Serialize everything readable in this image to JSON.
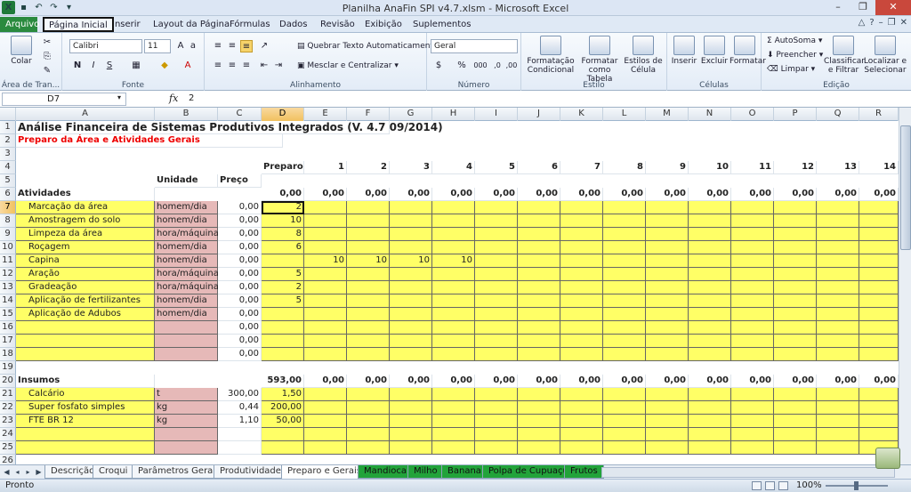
{
  "window": {
    "title": "Planilha AnaFin SPI v4.7.xlsm - Microsoft Excel"
  },
  "ribbon_tabs": [
    "Arquivo",
    "Página Inicial",
    "Inserir",
    "Layout da Página",
    "Fórmulas",
    "Dados",
    "Revisão",
    "Exibição",
    "Suplementos"
  ],
  "ribbon": {
    "clipboard": {
      "paste": "Colar",
      "label": "Área de Tran..."
    },
    "font": {
      "name": "Calibri",
      "size": "11",
      "bold": "N",
      "italic": "I",
      "underline": "S",
      "label": "Fonte"
    },
    "alignment": {
      "wrap": "Quebrar Texto Automaticamente",
      "merge": "Mesclar e Centralizar",
      "label": "Alinhamento"
    },
    "number": {
      "format": "Geral",
      "label": "Número"
    },
    "styles": {
      "cond": "Formatação Condicional",
      "table": "Formatar como Tabela",
      "cell": "Estilos de Célula",
      "label": "Estilo"
    },
    "cells": {
      "insert": "Inserir",
      "delete": "Excluir",
      "format": "Formatar",
      "label": "Células"
    },
    "editing": {
      "autosum": "AutoSoma",
      "fill": "Preencher",
      "clear": "Limpar",
      "sort": "Classificar e Filtrar",
      "find": "Localizar e Selecionar",
      "label": "Edição"
    }
  },
  "formula_bar": {
    "name_box": "D7",
    "fx": "fx",
    "value": "2"
  },
  "columns": [
    "A",
    "B",
    "C",
    "D",
    "E",
    "F",
    "G",
    "H",
    "I",
    "J",
    "K",
    "L",
    "M",
    "N",
    "O",
    "P",
    "Q",
    "R"
  ],
  "sheet": {
    "title": "Análise Financeira de Sistemas Produtivos Integrados (V. 4.7 09/2014)",
    "subtitle": "Preparo da Área e Atividades Gerais",
    "row4_d": "Preparo",
    "periods": [
      "1",
      "2",
      "3",
      "4",
      "5",
      "6",
      "7",
      "8",
      "9",
      "10",
      "11",
      "12",
      "13",
      "14"
    ],
    "hdr_unidade": "Unidade",
    "hdr_preco": "Preço",
    "atividades_label": "Atividades",
    "atividades_total": "0,00",
    "atividades_totals": [
      "0,00",
      "0,00",
      "0,00",
      "0,00",
      "0,00",
      "0,00",
      "0,00",
      "0,00",
      "0,00",
      "0,00",
      "0,00",
      "0,00",
      "0,00",
      "0,00"
    ],
    "activities": [
      {
        "row": "7",
        "name": "Marcação da área",
        "unit": "homem/dia",
        "price": "0,00",
        "d": "2",
        "e": "",
        "f": "",
        "g": "",
        "h": ""
      },
      {
        "row": "8",
        "name": "Amostragem do solo",
        "unit": "homem/dia",
        "price": "0,00",
        "d": "10",
        "e": "",
        "f": "",
        "g": "",
        "h": ""
      },
      {
        "row": "9",
        "name": "Limpeza da área",
        "unit": "hora/máquina",
        "price": "0,00",
        "d": "8",
        "e": "",
        "f": "",
        "g": "",
        "h": ""
      },
      {
        "row": "10",
        "name": "Roçagem",
        "unit": "homem/dia",
        "price": "0,00",
        "d": "6",
        "e": "",
        "f": "",
        "g": "",
        "h": ""
      },
      {
        "row": "11",
        "name": "Capina",
        "unit": "homem/dia",
        "price": "0,00",
        "d": "",
        "e": "10",
        "f": "10",
        "g": "10",
        "h": "10"
      },
      {
        "row": "12",
        "name": "Aração",
        "unit": "hora/máquina",
        "price": "0,00",
        "d": "5",
        "e": "",
        "f": "",
        "g": "",
        "h": ""
      },
      {
        "row": "13",
        "name": "Gradeação",
        "unit": "hora/máquina",
        "price": "0,00",
        "d": "2",
        "e": "",
        "f": "",
        "g": "",
        "h": ""
      },
      {
        "row": "14",
        "name": "Aplicação de fertilizantes",
        "unit": "homem/dia",
        "price": "0,00",
        "d": "5",
        "e": "",
        "f": "",
        "g": "",
        "h": ""
      },
      {
        "row": "15",
        "name": "Aplicação de Adubos",
        "unit": "homem/dia",
        "price": "0,00",
        "d": "",
        "e": "",
        "f": "",
        "g": "",
        "h": ""
      },
      {
        "row": "16",
        "name": "",
        "unit": "",
        "price": "0,00",
        "d": "",
        "e": "",
        "f": "",
        "g": "",
        "h": ""
      },
      {
        "row": "17",
        "name": "",
        "unit": "",
        "price": "0,00",
        "d": "",
        "e": "",
        "f": "",
        "g": "",
        "h": ""
      },
      {
        "row": "18",
        "name": "",
        "unit": "",
        "price": "0,00",
        "d": "",
        "e": "",
        "f": "",
        "g": "",
        "h": ""
      }
    ],
    "insumos_label": "Insumos",
    "insumos_total": "593,00",
    "insumos_totals": [
      "0,00",
      "0,00",
      "0,00",
      "0,00",
      "0,00",
      "0,00",
      "0,00",
      "0,00",
      "0,00",
      "0,00",
      "0,00",
      "0,00",
      "0,00",
      "0,00"
    ],
    "inputs": [
      {
        "row": "21",
        "name": "Calcário",
        "unit": "t",
        "price": "300,00",
        "d": "1,50"
      },
      {
        "row": "22",
        "name": "Super fosfato simples",
        "unit": "kg",
        "price": "0,44",
        "d": "200,00"
      },
      {
        "row": "23",
        "name": "FTE BR 12",
        "unit": "kg",
        "price": "1,10",
        "d": "50,00"
      },
      {
        "row": "24",
        "name": "",
        "unit": "",
        "price": "",
        "d": ""
      },
      {
        "row": "25",
        "name": "",
        "unit": "",
        "price": "",
        "d": ""
      }
    ]
  },
  "sheet_tabs": [
    "Descrição",
    "Croqui",
    "Parâmetros Gerais",
    "Produtividade",
    "Preparo e Gerais",
    "Mandioca",
    "Milho",
    "Banana",
    "Polpa de Cupuaçu",
    "Frutos"
  ],
  "status": {
    "ready": "Pronto",
    "zoom": "100%"
  },
  "colors": {
    "yellow": "#ffff66",
    "pink": "#e6b9b8",
    "green_tab": "#22a33a"
  }
}
